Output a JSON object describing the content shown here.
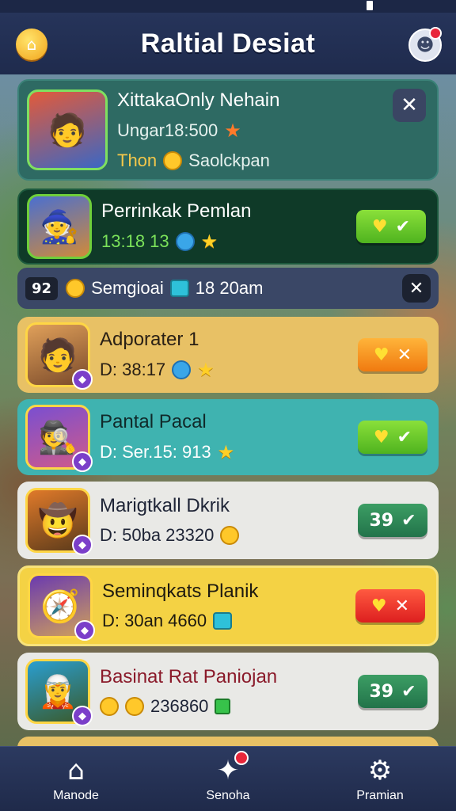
{
  "header": {
    "title": "Raltial Desiat"
  },
  "featured": {
    "name": "XittakaOnly Nehain",
    "stat": "Ungar18:500",
    "reward": "Thon",
    "reward_detail": "Saolckpan"
  },
  "highlight": {
    "name": "Perrinkak Pemlan",
    "stat": "13:18 13"
  },
  "strip": {
    "count": "92",
    "label": "Semgioai",
    "time": "18 20am"
  },
  "items": [
    {
      "name": "Adporater 1",
      "stat": "D: 38:17"
    },
    {
      "name": "Pantal Pacal",
      "stat": "D: Ser.15: 913"
    },
    {
      "name": "Marigtkall Dkrik",
      "stat": "D: 50ba 23320",
      "badge": "39"
    },
    {
      "name": "Seminqkats Planik",
      "stat": "D: 30an 4660"
    },
    {
      "name": "Basinat Rat Paniojan",
      "stat": "236860",
      "badge": "39"
    }
  ],
  "nav": {
    "home": "Manode",
    "social": "Senoha",
    "settings": "Pramian"
  },
  "colors": {
    "accent": "#ffd645",
    "card_featured": "#2e6a63",
    "card_highlight": "#0f3a28",
    "card_orange": "#e8c165",
    "card_teal": "#3fb3b0",
    "card_light": "#e9e9e6",
    "card_yellow": "#f4d244",
    "nav_bg": "#1f2a4a"
  },
  "icons": [
    "home-icon",
    "profile-icon",
    "close-icon",
    "star-icon",
    "heart-icon",
    "check-icon",
    "coin-icon",
    "gear-icon",
    "puzzle-icon"
  ]
}
